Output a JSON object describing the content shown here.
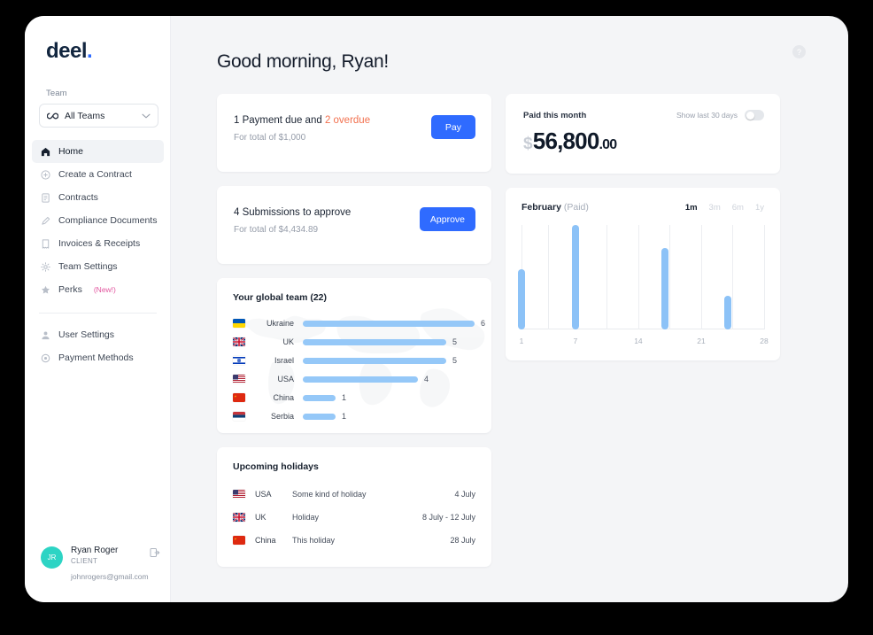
{
  "brand": {
    "name": "deel",
    "dot": "."
  },
  "sidebar": {
    "team_label": "Team",
    "team_select": {
      "value": "All Teams",
      "icon": "infinity-icon",
      "chevron": "chevron-down-icon"
    },
    "items": [
      {
        "label": "Home",
        "icon": "home-icon",
        "active": true
      },
      {
        "label": "Create a Contract",
        "icon": "plus-circle-icon",
        "active": false
      },
      {
        "label": "Contracts",
        "icon": "document-icon",
        "active": false
      },
      {
        "label": "Compliance Documents",
        "icon": "pen-icon",
        "active": false
      },
      {
        "label": "Invoices & Receipts",
        "icon": "receipt-icon",
        "active": false
      },
      {
        "label": "Team Settings",
        "icon": "gear-icon",
        "active": false
      },
      {
        "label": "Perks",
        "icon": "star-icon",
        "active": false,
        "badge": "(New!)"
      }
    ],
    "secondary_items": [
      {
        "label": "User Settings",
        "icon": "user-icon"
      },
      {
        "label": "Payment Methods",
        "icon": "credit-card-icon"
      }
    ],
    "user": {
      "initials": "JR",
      "name": "Ryan Roger",
      "role": "CLIENT",
      "email": "johnrogers@gmail.com",
      "logout_icon": "logout-icon"
    }
  },
  "header": {
    "title": "Good morning, Ryan!",
    "help_icon": "question-mark-icon",
    "help_glyph": "?"
  },
  "payment_card": {
    "title_prefix": "1 Payment due and ",
    "title_warn": "2 overdue",
    "subtitle": "For total of $1,000",
    "button": "Pay"
  },
  "submissions_card": {
    "title": "4 Submissions to approve",
    "subtitle": "For total of $4,434.89",
    "button": "Approve"
  },
  "paid_card": {
    "label": "Paid this month",
    "toggle_label": "Show last 30 days",
    "toggle_on": false,
    "currency": "$",
    "amount": "56,800",
    "cents": ".00"
  },
  "chart_card": {
    "title": "February ",
    "title_muted": "(Paid)",
    "ranges": [
      {
        "label": "1m",
        "active": true
      },
      {
        "label": "3m",
        "active": false
      },
      {
        "label": "6m",
        "active": false
      },
      {
        "label": "1y",
        "active": false
      }
    ]
  },
  "chart_data": {
    "type": "bar",
    "title": "February (Paid)",
    "xlabel": "",
    "ylabel": "",
    "xticks": [
      1,
      7,
      14,
      21,
      28
    ],
    "xlim": [
      1,
      28
    ],
    "ylim": [
      0,
      100
    ],
    "grid": true,
    "legend": "none",
    "bar_color": "#8cc2f7",
    "x": [
      1,
      7,
      17,
      24
    ],
    "values": [
      58,
      100,
      78,
      32
    ],
    "categories": [
      "1",
      "7",
      "17",
      "24"
    ]
  },
  "team_card": {
    "heading": "Your global team (22)",
    "max_value": 6,
    "rows": [
      {
        "country": "Ukraine",
        "value": 6,
        "flag": "ukraine-flag-icon"
      },
      {
        "country": "UK",
        "value": 5,
        "flag": "uk-flag-icon"
      },
      {
        "country": "Israel",
        "value": 5,
        "flag": "israel-flag-icon"
      },
      {
        "country": "USA",
        "value": 4,
        "flag": "usa-flag-icon"
      },
      {
        "country": "China",
        "value": 1,
        "flag": "china-flag-icon"
      },
      {
        "country": "Serbia",
        "value": 1,
        "flag": "serbia-flag-icon"
      }
    ]
  },
  "holidays_card": {
    "heading": "Upcoming holidays",
    "rows": [
      {
        "country": "USA",
        "name": "Some kind of holiday",
        "date": "4 July",
        "flag": "usa-flag-icon"
      },
      {
        "country": "UK",
        "name": "Holiday",
        "date": "8 July - 12 July",
        "flag": "uk-flag-icon"
      },
      {
        "country": "China",
        "name": "This holiday",
        "date": "28 July",
        "flag": "china-flag-icon"
      }
    ]
  },
  "colors": {
    "accent": "#2f6bff",
    "warn": "#f2704e",
    "bar": "#8cc2f7",
    "badge": "#e2569f",
    "avatar": "#2dd4c4",
    "page_bg": "#f4f5f7"
  }
}
